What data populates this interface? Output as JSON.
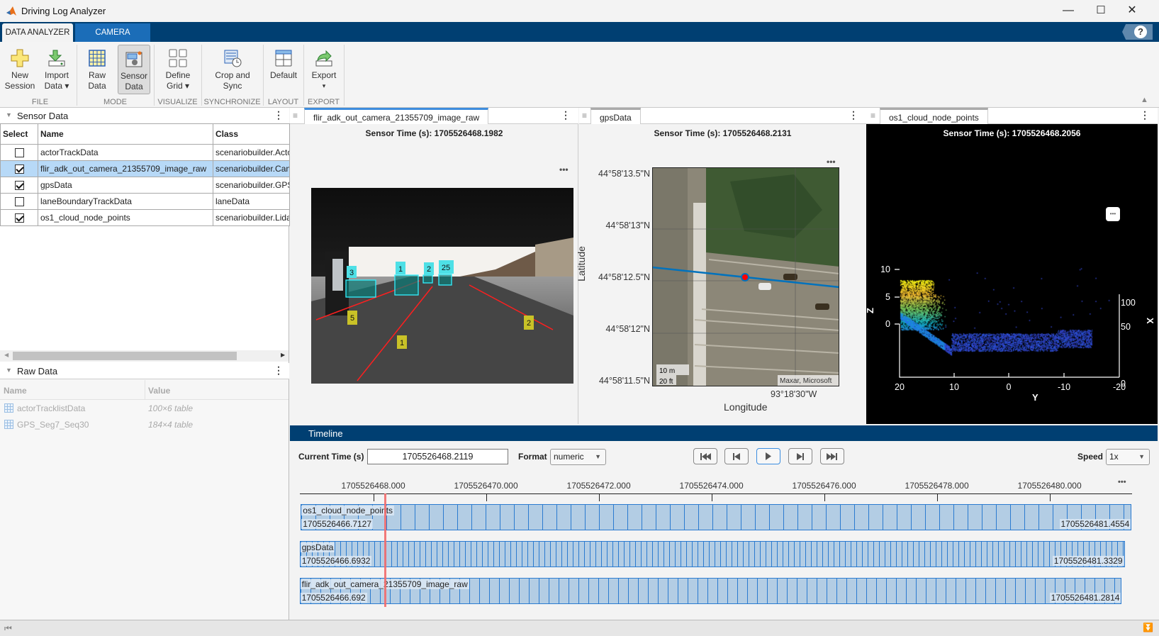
{
  "window": {
    "title": "Driving Log Analyzer"
  },
  "ribbon": {
    "tabs": [
      "DATA ANALYZER",
      "CAMERA"
    ],
    "groups": [
      {
        "label": "FILE",
        "buttons": [
          {
            "lines": [
              "New",
              "Session"
            ],
            "icon": "plus-icon"
          },
          {
            "lines": [
              "Import",
              "Data ▾"
            ],
            "icon": "import-icon"
          }
        ]
      },
      {
        "label": "MODE",
        "buttons": [
          {
            "lines": [
              "Raw",
              "Data"
            ],
            "icon": "table-grid-icon"
          },
          {
            "lines": [
              "Sensor",
              "Data"
            ],
            "icon": "sensor-icon",
            "selected": true
          }
        ]
      },
      {
        "label": "VISUALIZE",
        "buttons": [
          {
            "lines": [
              "Define",
              "Grid ▾"
            ],
            "icon": "grid-layout-icon"
          }
        ]
      },
      {
        "label": "SYNCHRONIZE",
        "buttons": [
          {
            "lines": [
              "Crop and",
              "Sync"
            ],
            "icon": "crop-sync-icon"
          }
        ]
      },
      {
        "label": "LAYOUT",
        "buttons": [
          {
            "lines": [
              "Default",
              ""
            ],
            "icon": "layout-icon"
          }
        ]
      },
      {
        "label": "EXPORT",
        "buttons": [
          {
            "lines": [
              "Export",
              "▾"
            ],
            "icon": "export-icon"
          }
        ]
      }
    ]
  },
  "sensor_panel": {
    "title": "Sensor Data",
    "columns": [
      "Select",
      "Name",
      "Class"
    ],
    "rows": [
      {
        "selected": false,
        "name": "actorTrackData",
        "class": "scenariobuilder.Acto"
      },
      {
        "selected": true,
        "name": "flir_adk_out_camera_21355709_image_raw",
        "class": "scenariobuilder.Can"
      },
      {
        "selected": true,
        "name": "gpsData",
        "class": "scenariobuilder.GPS"
      },
      {
        "selected": false,
        "name": "laneBoundaryTrackData",
        "class": "laneData"
      },
      {
        "selected": true,
        "name": "os1_cloud_node_points",
        "class": "scenariobuilder.Lida"
      }
    ]
  },
  "raw_panel": {
    "title": "Raw Data",
    "columns": [
      "Name",
      "Value"
    ],
    "rows": [
      {
        "name": "actorTracklistData",
        "value": "100×6 table"
      },
      {
        "name": "GPS_Seg7_Seq30",
        "value": "184×4 table"
      }
    ]
  },
  "camera_panel": {
    "tab": "flir_adk_out_camera_21355709_image_raw",
    "sensor_time": "Sensor Time (s): 1705526468.1982",
    "actor_labels": [
      "3",
      "1",
      "2",
      "25"
    ],
    "lane_labels": [
      "5",
      "1",
      "2"
    ]
  },
  "gps_panel": {
    "tab": "gpsData",
    "sensor_time": "Sensor Time (s): 1705526468.2131",
    "lat_ticks": [
      "44°58'13.5\"N",
      "44°58'13\"N",
      "44°58'12.5\"N",
      "44°58'12\"N",
      "44°58'11.5\"N"
    ],
    "lon_tick": "93°18'30\"W",
    "xlabel": "Longitude",
    "ylabel": "Latitude",
    "scale_m": "10 m",
    "scale_ft": "20 ft",
    "attribution": "Maxar, Microsoft",
    "track_color": "#0072bd",
    "marker_color": "#ff0000"
  },
  "lidar_panel": {
    "tab": "os1_cloud_node_points",
    "sensor_time": "Sensor Time (s): 1705526468.2056",
    "y_ticks": [
      "20",
      "10",
      "0",
      "-10",
      "-20"
    ],
    "z_ticks": [
      "10",
      "5",
      "0"
    ],
    "x_ticks": [
      "100",
      "50",
      "0"
    ],
    "xlabel": "X",
    "ylabel": "Y",
    "zlabel": "Z"
  },
  "timeline": {
    "title": "Timeline",
    "current_time_label": "Current Time (s)",
    "current_time": "1705526468.2119",
    "format_label": "Format",
    "format_value": "numeric",
    "speed_label": "Speed",
    "speed_value": "1x",
    "cursor_time": 1705526468.2119,
    "axis_ticks": [
      "1705526468.000",
      "1705526470.000",
      "1705526472.000",
      "1705526474.000",
      "1705526476.000",
      "1705526478.000",
      "1705526480.000"
    ],
    "tracks": [
      {
        "name": "os1_cloud_node_points",
        "start": "1705526466.7127",
        "end": "1705526481.4554"
      },
      {
        "name": "gpsData",
        "start": "1705526466.6932",
        "end": "1705526481.3329"
      },
      {
        "name": "flir_adk_out_camera_21355709_image_raw",
        "start": "1705526466.692",
        "end": "1705526481.2814"
      }
    ],
    "cursor_color": "#f26b6b",
    "track_color": "#b3cde4"
  }
}
